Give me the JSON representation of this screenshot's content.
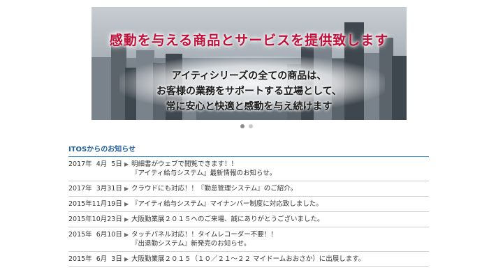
{
  "banner": {
    "headline": "感動を与える商品とサービスを提供致します",
    "line1": "アイティシリーズの全ての商品は、",
    "line2": "お客様の業務をサポートする立場として、",
    "line3": "常に安心と快適と感動を与え続けます"
  },
  "carousel": {
    "slide_count": 2,
    "active_index": 0
  },
  "news": {
    "title": "ITOSからのお知らせ",
    "bullet": "▶",
    "items": [
      {
        "date": "2017年  4月  5日",
        "lines": [
          "明細書がウェブで閲覧できます！！",
          "『アイティ給与システム』最新情報のお知らせ。"
        ]
      },
      {
        "date": "2017年  3月31日",
        "lines": [
          "クラウドにも対応！！『勤怠管理システム』のご紹介。"
        ]
      },
      {
        "date": "2015年11月19日",
        "lines": [
          "『アイティ給与システム』マイナンバー制度に対応致しました。"
        ]
      },
      {
        "date": "2015年10月23日",
        "lines": [
          "大阪勤業展２０１５へのご来場、誠にありがとうございました。"
        ]
      },
      {
        "date": "2015年  6月10日",
        "lines": [
          "タッチパネル対応！！タイムレコーダー不要！！",
          "『出退勤システム』新発売のお知らせ。"
        ]
      },
      {
        "date": "2015年  6月  3日",
        "lines": [
          "大阪勤業展２０１５（１０／２１～２２ マイドームおおさか）に出展します。"
        ]
      }
    ]
  },
  "colors": {
    "headline": "#c0103a",
    "news_title": "#1f5d9c",
    "rule": "#3a8fd0"
  }
}
